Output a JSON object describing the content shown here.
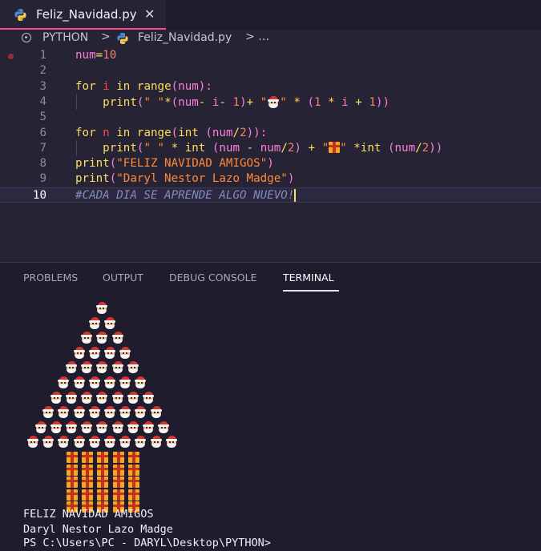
{
  "tab": {
    "title": "Feliz_Navidad.py",
    "close": "✕"
  },
  "breadcrumb": {
    "root": "PYTHON",
    "sep": ">",
    "file": "Feliz_Navidad.py",
    "sep2": "> …"
  },
  "editor": {
    "line_numbers": [
      "1",
      "2",
      "3",
      "4",
      "5",
      "6",
      "7",
      "8",
      "9",
      "10"
    ],
    "l1": {
      "var": "num",
      "op": "=",
      "num": "10"
    },
    "l3": {
      "kw1": "for",
      "v": "i",
      "kw2": "in",
      "fn": "range",
      "p1": "(",
      "arg": "num",
      "p2": "):"
    },
    "l4": {
      "fn": "print",
      "p1": "(",
      "s1": "\" \"",
      "op1": "*",
      "p2": "(",
      "a1": "num",
      "op2": "-",
      "a2": "i",
      "op3": "-",
      "n1": "1",
      "p3": ")",
      "op4": "+",
      "s2a": "\"",
      "s2b": "\"",
      "op5": "*",
      "p4": "(",
      "n2": "1",
      "op6": "*",
      "a3": "i",
      "op7": "+",
      "n3": "1",
      "p5": "))"
    },
    "l6": {
      "kw1": "for",
      "v": "n",
      "kw2": "in",
      "fn": "range",
      "p1": "(",
      "fn2": "int",
      "p2": "(",
      "arg": "num",
      "op": "/",
      "n": "2",
      "p3": ")):"
    },
    "l7": {
      "fn": "print",
      "p1": "(",
      "s1": "\" \"",
      "op1": "*",
      "fn2": "int",
      "p2": "(",
      "a1": "num",
      "op2": "-",
      "a2": "num",
      "op3": "/",
      "n1": "2",
      "p3": ")",
      "op4": "+",
      "s2a": "\"",
      "s2b": "\"",
      "op5": "*",
      "fn3": "int",
      "p4": "(",
      "a3": "num",
      "op6": "/",
      "n2": "2",
      "p5": "))"
    },
    "l8": {
      "fn": "print",
      "p1": "(",
      "s": "\"FELIZ NAVIDAD AMIGOS\"",
      "p2": ")"
    },
    "l9": {
      "fn": "print",
      "p1": "(",
      "s": "\"Daryl Nestor Lazo Madge\"",
      "p2": ")"
    },
    "l10": {
      "comment": "#CADA DIA SE APRENDE ALGO NUEVO!"
    }
  },
  "panel": {
    "tabs": [
      "PROBLEMS",
      "OUTPUT",
      "DEBUG CONSOLE",
      "TERMINAL"
    ],
    "active_tab": "TERMINAL"
  },
  "terminal": {
    "tree_rows": [
      1,
      2,
      3,
      4,
      5,
      6,
      7,
      8,
      9,
      10
    ],
    "trunk_rows": 5,
    "trunk_width": 5,
    "output": [
      "FELIZ NAVIDAD AMIGOS",
      "Daryl Nestor Lazo Madge"
    ],
    "prompt": "PS C:\\Users\\PC - DARYL\\Desktop\\PYTHON>"
  },
  "icons": {
    "file_icon": "python-icon",
    "tree_icon": "santa-emoji",
    "trunk_icon": "gift-emoji"
  },
  "colors": {
    "accent": "#fe4b92",
    "keyword": "#fede5d",
    "function": "#fe4450",
    "string": "#ff8b39",
    "variable": "#ff7edb",
    "comment": "#848bbd"
  }
}
